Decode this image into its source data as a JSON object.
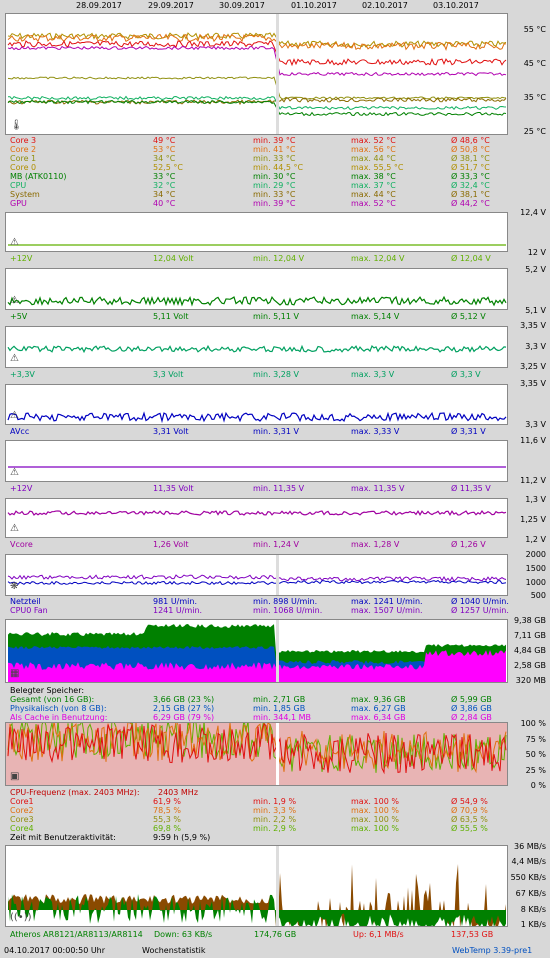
{
  "dates": [
    "28.09.2017",
    "29.09.2017",
    "30.09.2017",
    "01.10.2017",
    "02.10.2017",
    "03.10.2017"
  ],
  "temp": {
    "scale": [
      "55 °C",
      "45 °C",
      "35 °C",
      "25 °C"
    ],
    "rows": [
      {
        "name": "Core 3",
        "cur": "49 °C",
        "min": "min. 39 °C",
        "max": "max. 52 °C",
        "avg": "Ø 48,6 °C",
        "color": "#e01010"
      },
      {
        "name": "Core 2",
        "cur": "53 °C",
        "min": "min. 41 °C",
        "max": "max. 56 °C",
        "avg": "Ø 50,8 °C",
        "color": "#e07010"
      },
      {
        "name": "Core 1",
        "cur": "34 °C",
        "min": "min. 33 °C",
        "max": "max. 44 °C",
        "avg": "Ø 38,1 °C",
        "color": "#909010"
      },
      {
        "name": "Core 0",
        "cur": "52,5 °C",
        "min": "min. 44,5 °C",
        "max": "max. 55,5 °C",
        "avg": "Ø 51,7 °C",
        "color": "#b09000"
      },
      {
        "name": "MB (ATK0110)",
        "cur": "33 °C",
        "min": "min. 30 °C",
        "max": "max. 38 °C",
        "avg": "Ø 33,3 °C",
        "color": "#008000"
      },
      {
        "name": "CPU",
        "cur": "32 °C",
        "min": "min. 29 °C",
        "max": "max. 37 °C",
        "avg": "Ø 32,4 °C",
        "color": "#10b060"
      },
      {
        "name": "System",
        "cur": "34 °C",
        "min": "min. 33 °C",
        "max": "max. 44 °C",
        "avg": "Ø 38,1 °C",
        "color": "#8a6a00"
      },
      {
        "name": "GPU",
        "cur": "40 °C",
        "min": "min. 39 °C",
        "max": "max. 52 °C",
        "avg": "Ø 44,2 °C",
        "color": "#b000b0"
      }
    ]
  },
  "volt12": {
    "scale": [
      "12,4 V",
      "12 V"
    ],
    "row": {
      "name": "+12V",
      "cur": "12,04 Volt",
      "min": "min. 12,04 V",
      "max": "max. 12,04 V",
      "avg": "Ø 12,04 V",
      "color": "#60b000"
    }
  },
  "volt5": {
    "scale": [
      "5,2 V",
      "5,1 V"
    ],
    "row": {
      "name": "+5V",
      "cur": "5,11 Volt",
      "min": "min. 5,11 V",
      "max": "max. 5,14 V",
      "avg": "Ø 5,12 V",
      "color": "#008000"
    }
  },
  "volt33": {
    "scale": [
      "3,35 V",
      "3,3 V",
      "3,25 V"
    ],
    "row": {
      "name": "+3,3V",
      "cur": "3,3 Volt",
      "min": "min. 3,28 V",
      "max": "max. 3,3 V",
      "avg": "Ø 3,3 V",
      "color": "#00a060"
    }
  },
  "avcc": {
    "scale": [
      "3,35 V",
      "3,3 V"
    ],
    "row": {
      "name": "AVcc",
      "cur": "3,31 Volt",
      "min": "min. 3,31 V",
      "max": "max. 3,33 V",
      "avg": "Ø 3,31 V",
      "color": "#0000c0"
    }
  },
  "v12b": {
    "scale": [
      "11,6 V",
      "11,2 V"
    ],
    "row": {
      "name": "+12V",
      "cur": "11,35 Volt",
      "min": "min. 11,35 V",
      "max": "max. 11,35 V",
      "avg": "Ø 11,35 V",
      "color": "#8000c0"
    }
  },
  "vcore": {
    "scale": [
      "1,3 V",
      "1,25 V",
      "1,2 V"
    ],
    "row": {
      "name": "Vcore",
      "cur": "1,26 Volt",
      "min": "min. 1,24 V",
      "max": "max. 1,28 V",
      "avg": "Ø 1,26 V",
      "color": "#a000a0"
    }
  },
  "fans": {
    "scale": [
      "2000",
      "1500",
      "1000",
      "500"
    ],
    "rows": [
      {
        "name": "Netzteil",
        "cur": "981 U/min.",
        "min": "min. 898 U/min.",
        "max": "max. 1241 U/min.",
        "avg": "Ø 1040 U/min.",
        "color": "#0000c0"
      },
      {
        "name": "CPU0 Fan",
        "cur": "1241 U/min.",
        "min": "min. 1068 U/min.",
        "max": "max. 1507 U/min.",
        "avg": "Ø 1257 U/min.",
        "color": "#8000c0"
      }
    ]
  },
  "mem": {
    "scale": [
      "9,38 GB",
      "7,11 GB",
      "4,84 GB",
      "2,58 GB",
      "320 MB"
    ],
    "header": "Belegter Speicher:",
    "rows": [
      {
        "name": "Gesamt (von 16 GB):",
        "cur": "3,66 GB (23 %)",
        "min": "min. 2,71 GB",
        "max": "max. 9,36 GB",
        "avg": "Ø 5,99 GB",
        "color": "#008000"
      },
      {
        "name": "Physikalisch (von 8 GB):",
        "cur": "2,15 GB (27 %)",
        "min": "min. 1,85 GB",
        "max": "max. 6,27 GB",
        "avg": "Ø 3,86 GB",
        "color": "#0050c0"
      },
      {
        "name": "Als Cache in Benutzung:",
        "cur": "6,29 GB (79 %)",
        "min": "min. 344,1 MB",
        "max": "max. 6,34 GB",
        "avg": "Ø 2,84 GB",
        "color": "#e000e0"
      }
    ]
  },
  "cpu": {
    "scale": [
      "100 %",
      "75 %",
      "50 %",
      "25 %",
      "0 %"
    ],
    "header": {
      "name": "CPU-Frequenz (max. 2403 MHz):",
      "cur": "2403 MHz",
      "color": "#c00000"
    },
    "rows": [
      {
        "name": "Core1",
        "cur": "61,9 %",
        "min": "min. 1,9 %",
        "max": "max. 100 %",
        "avg": "Ø 54,9 %",
        "color": "#e01010"
      },
      {
        "name": "Core2",
        "cur": "78,5 %",
        "min": "min. 3,3 %",
        "max": "max. 100 %",
        "avg": "Ø 70,9 %",
        "color": "#e07010"
      },
      {
        "name": "Core3",
        "cur": "55,3 %",
        "min": "min. 2,2 %",
        "max": "max. 100 %",
        "avg": "Ø 63,5 %",
        "color": "#909010"
      },
      {
        "name": "Core4",
        "cur": "69,8 %",
        "min": "min. 2,9 %",
        "max": "max. 100 %",
        "avg": "Ø 55,5 %",
        "color": "#60b000"
      }
    ],
    "activity": {
      "label": "Zeit mit Benutzeraktivität:",
      "value": "9:59 h (5,9 %)"
    }
  },
  "net": {
    "scale": [
      "36 MB/s",
      "4,4 MB/s",
      "550 KB/s",
      "67 KB/s",
      "8 KB/s",
      "1 KB/s"
    ],
    "adapter": "Atheros AR8121/AR8113/AR8114",
    "down": "Down: 63 KB/s",
    "downtotal": "174,76 GB",
    "up": "Up: 6,1 MB/s",
    "uptotal": "137,53 GB"
  },
  "footer": {
    "timestamp": "04.10.2017 00:00:50 Uhr",
    "mode": "Wochenstatistik",
    "app": "WebTemp 3.39-pre1"
  }
}
